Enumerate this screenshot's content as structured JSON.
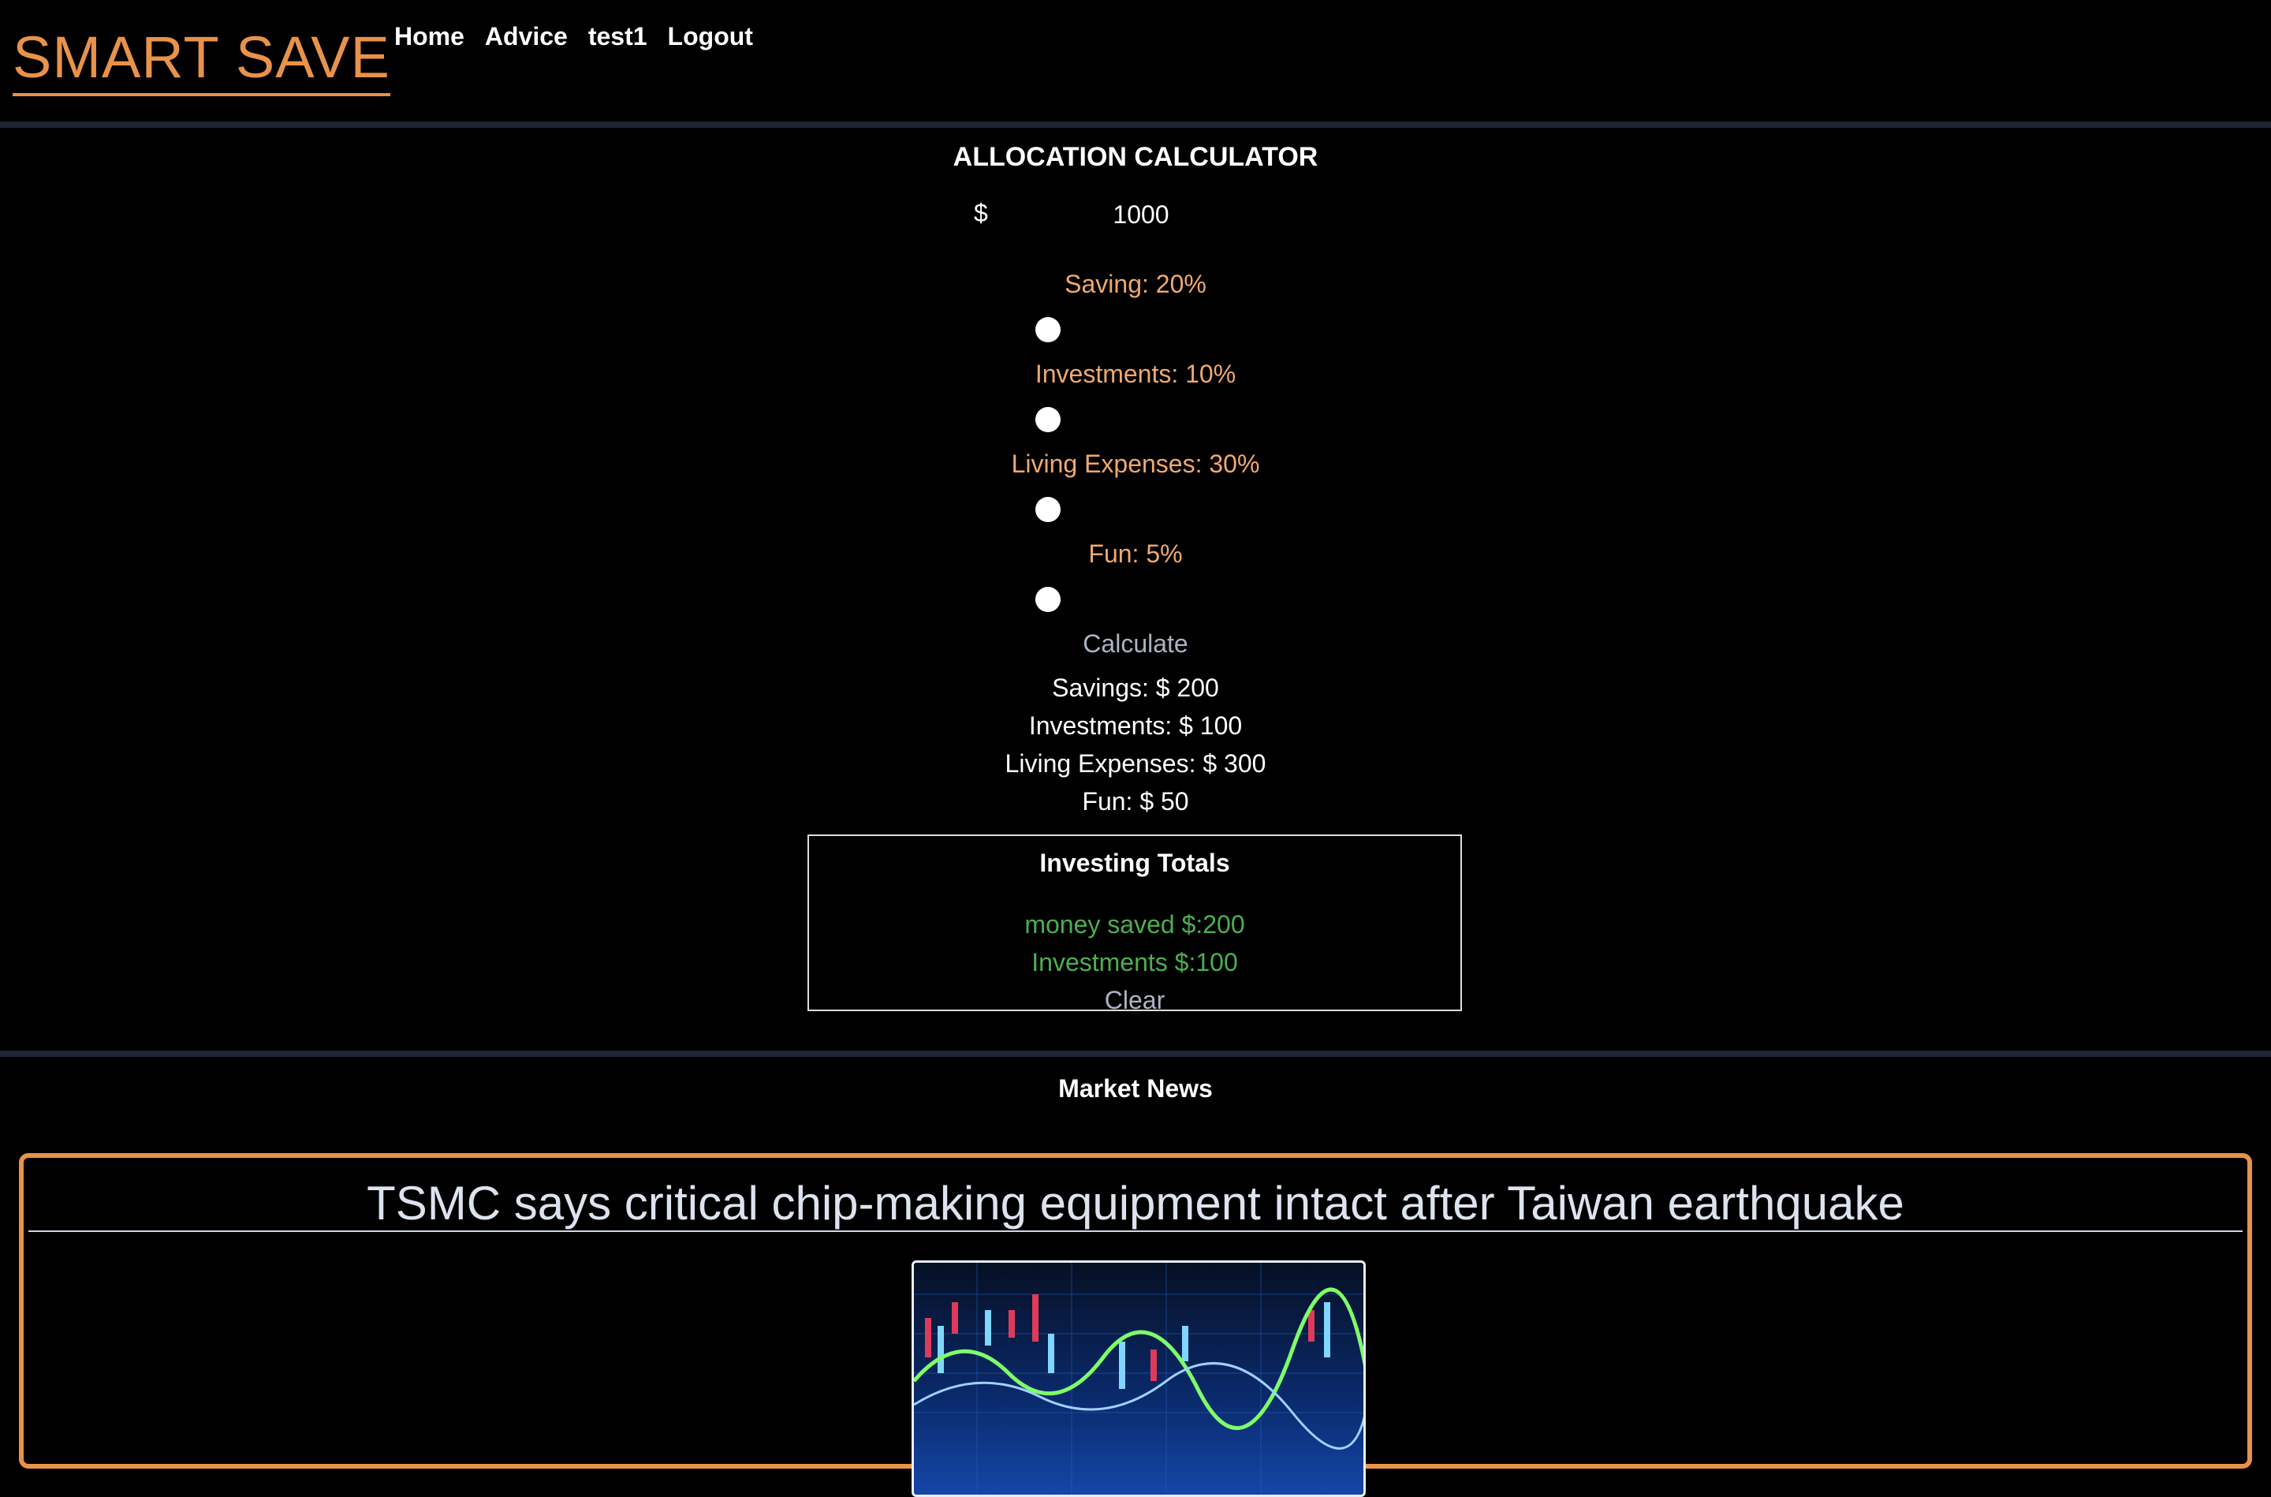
{
  "header": {
    "brand": "SMART SAVE",
    "nav": [
      {
        "label": "Home"
      },
      {
        "label": "Advice"
      },
      {
        "label": "test1"
      },
      {
        "label": "Logout"
      }
    ]
  },
  "calculator": {
    "title": "ALLOCATION CALCULATOR",
    "currency": "$",
    "amount": "1000",
    "sliders": [
      {
        "label": "Saving: 20%",
        "value_percent": 20
      },
      {
        "label": "Investments: 10%",
        "value_percent": 10
      },
      {
        "label": "Living Expenses: 30%",
        "value_percent": 30
      },
      {
        "label": "Fun: 5%",
        "value_percent": 5
      }
    ],
    "calculate_label": "Calculate",
    "results": [
      "Savings: $ 200",
      "Investments: $ 100",
      "Living Expenses: $ 300",
      "Fun: $ 50"
    ]
  },
  "totals": {
    "title": "Investing Totals",
    "money_saved": "money saved $:200",
    "investments": "Investments $:100",
    "clear_label": "Clear"
  },
  "news": {
    "section_title": "Market News",
    "articles": [
      {
        "headline": "TSMC says critical chip-making equipment intact after Taiwan earthquake",
        "image": "stock-chart-image"
      }
    ]
  },
  "colors": {
    "accent": "#e8924a",
    "slider_label": "#f0a96e",
    "totals_text": "#4caf50",
    "muted_button": "#aab4c4",
    "divider": "#1e2533"
  }
}
